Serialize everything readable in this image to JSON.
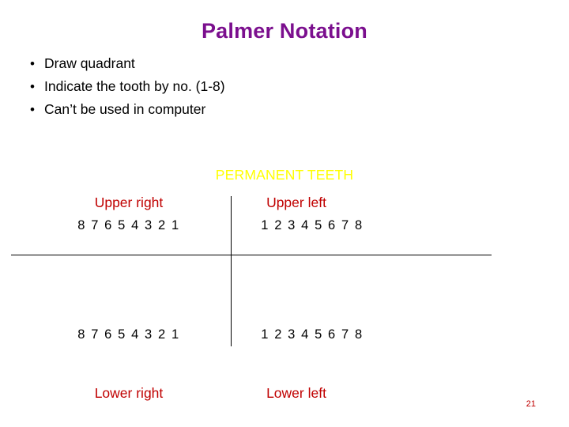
{
  "slide": {
    "title": "Palmer Notation",
    "bullet_marker": "•",
    "bullets": [
      "Draw quadrant",
      "Indicate the tooth by no. (1-8)",
      "Can’t be used in computer"
    ],
    "diagram": {
      "heading": "PERMANENT TEETH",
      "upper_right_label": "Upper right",
      "upper_right_numbers": "8 7 6 5 4 3 2 1",
      "upper_left_label": "Upper left",
      "upper_left_numbers": "1 2 3 4 5 6 7 8",
      "lower_right_numbers": "8 7 6 5 4 3 2 1",
      "lower_left_numbers": "1 2 3 4 5 6 7 8",
      "lower_right_label": "Lower right",
      "lower_left_label": "Lower left"
    },
    "page_number": "21",
    "colors": {
      "title": "#7b0f8e",
      "heading": "#ffff00",
      "quadrant_label": "#c00000",
      "numbers": "#000000"
    }
  }
}
